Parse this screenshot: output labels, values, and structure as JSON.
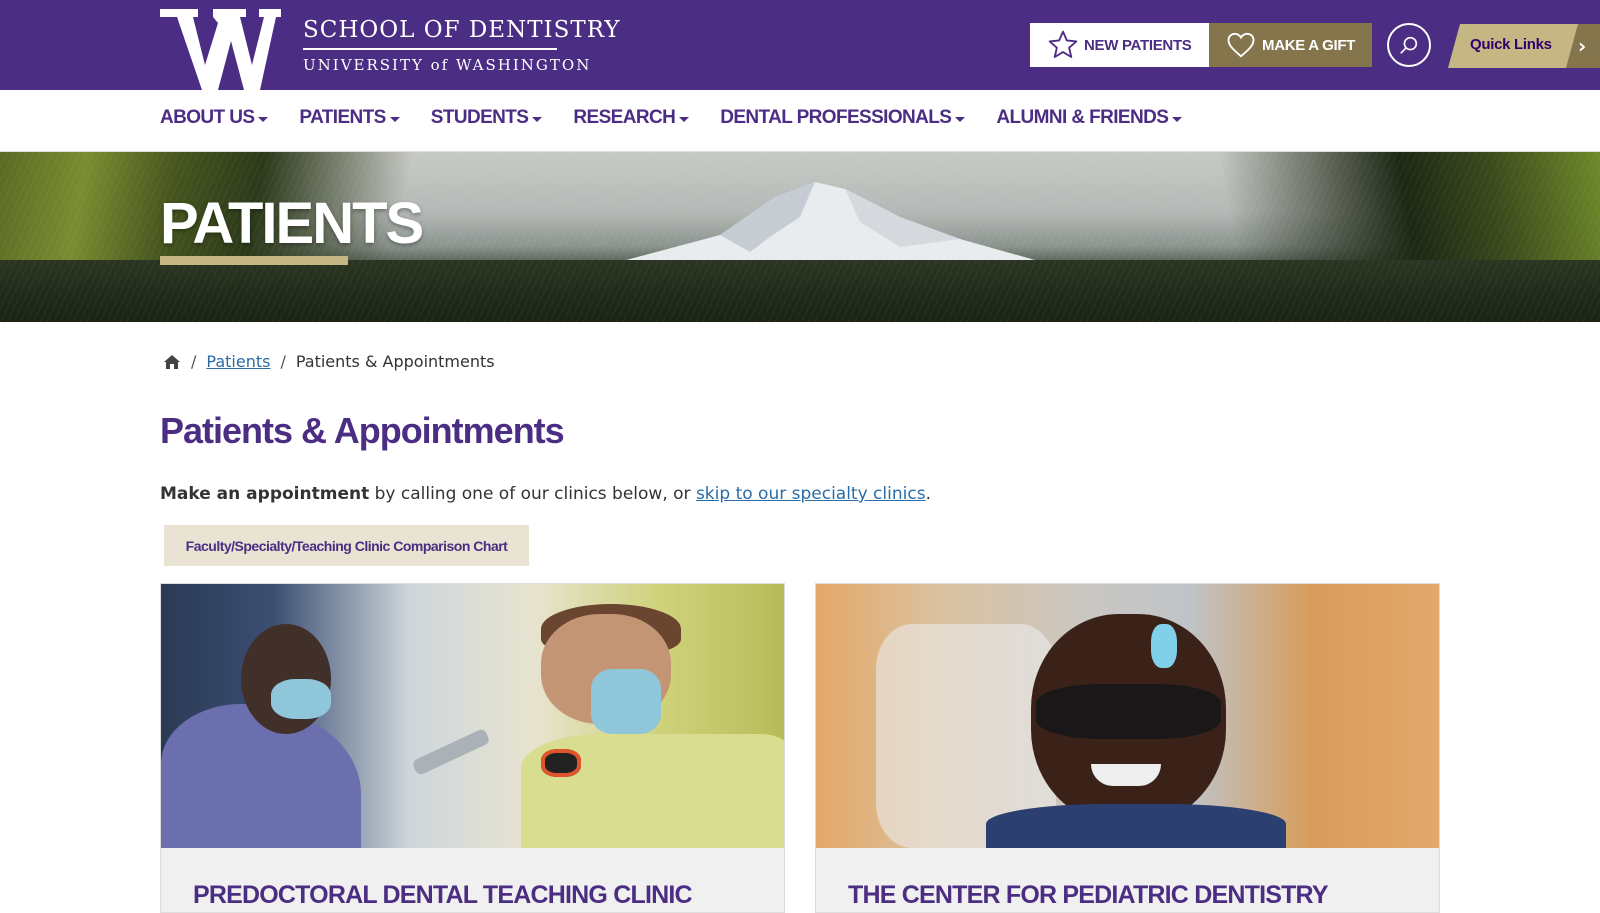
{
  "header": {
    "school": "SCHOOL OF DENTISTRY",
    "university": "UNIVERSITY of WASHINGTON",
    "new_patients": "NEW PATIENTS",
    "make_gift": "MAKE A GIFT",
    "quick_links": "Quick Links"
  },
  "nav": {
    "items": [
      {
        "label": "ABOUT US"
      },
      {
        "label": "PATIENTS"
      },
      {
        "label": "STUDENTS"
      },
      {
        "label": "RESEARCH"
      },
      {
        "label": "DENTAL PROFESSIONALS"
      },
      {
        "label": "ALUMNI & FRIENDS"
      }
    ]
  },
  "hero": {
    "title": "PATIENTS"
  },
  "breadcrumb": {
    "parent": "Patients",
    "current": "Patients & Appointments"
  },
  "content": {
    "title": "Patients & Appointments",
    "intro_bold": "Make an appointment",
    "intro_text": " by calling one of our clinics below, or ",
    "intro_link": "skip to our specialty clinics",
    "intro_end": ".",
    "chart_button": "Faculty/Specialty/Teaching Clinic Comparison Chart"
  },
  "cards": [
    {
      "title": "PREDOCTORAL DENTAL TEACHING CLINIC"
    },
    {
      "title": "THE CENTER FOR PEDIATRIC DENTISTRY"
    }
  ],
  "colors": {
    "brand_purple": "#4b2e83",
    "gold": "#85754d",
    "tan": "#c5b783",
    "link": "#2a6ca8"
  },
  "icons": [
    "uw-logo",
    "star-icon",
    "heart-icon",
    "search-icon",
    "chevron-right-icon",
    "home-icon"
  ]
}
